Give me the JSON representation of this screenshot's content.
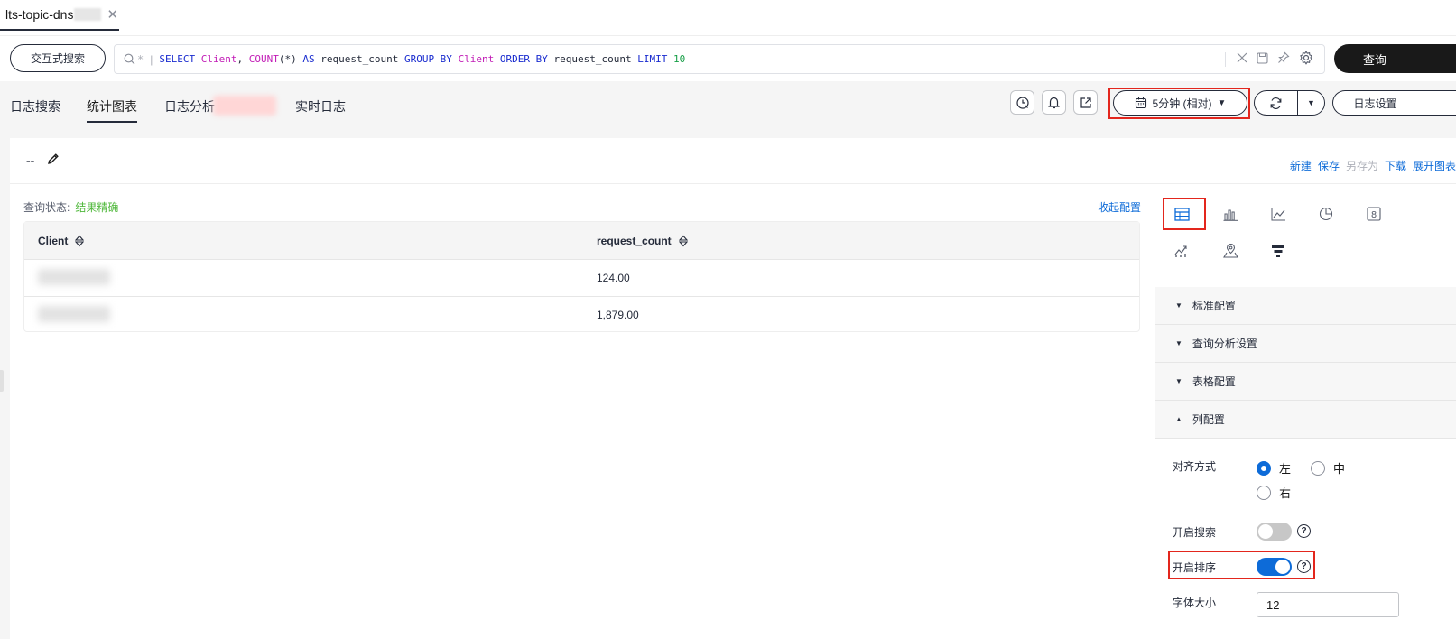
{
  "file_tab": {
    "name": "lts-topic-dns"
  },
  "query_bar": {
    "interactive_label": "交互式搜索",
    "search_star": "*",
    "sql_tokens": [
      {
        "t": "SELECT",
        "c": "kw"
      },
      {
        "t": " ",
        "c": "plain"
      },
      {
        "t": "Client",
        "c": "fn"
      },
      {
        "t": ", ",
        "c": "plain"
      },
      {
        "t": "COUNT",
        "c": "fn"
      },
      {
        "t": "(*)",
        "c": "plain"
      },
      {
        "t": " AS ",
        "c": "kw"
      },
      {
        "t": "request_count",
        "c": "plain"
      },
      {
        "t": " GROUP BY ",
        "c": "kw"
      },
      {
        "t": "Client",
        "c": "fn"
      },
      {
        "t": " ORDER BY ",
        "c": "kw"
      },
      {
        "t": "request_count",
        "c": "plain"
      },
      {
        "t": " LIMIT ",
        "c": "kw"
      },
      {
        "t": "10",
        "c": "num"
      }
    ],
    "query_label": "查询"
  },
  "tabs": [
    {
      "label": "日志搜索",
      "active": false
    },
    {
      "label": "统计图表",
      "active": true
    },
    {
      "label": "日志分析",
      "active": false
    },
    {
      "label": "实时日志",
      "active": false
    }
  ],
  "toolbar": {
    "time_range": "5分钟 (相对)",
    "log_settings": "日志设置"
  },
  "card": {
    "title": "--",
    "actions": {
      "new": "新建",
      "save": "保存",
      "save_as": "另存为",
      "download": "下载",
      "expand": "展开图表"
    },
    "query_status_label": "查询状态:",
    "query_status_value": "结果精确",
    "collapse_config": "收起配置"
  },
  "table": {
    "columns": [
      "Client",
      "request_count"
    ],
    "rows": [
      {
        "client": "",
        "count": "124.00"
      },
      {
        "client": "",
        "count": "1,879.00"
      }
    ]
  },
  "panel": {
    "sections": [
      {
        "label": "标准配置",
        "open": false
      },
      {
        "label": "查询分析设置",
        "open": false
      },
      {
        "label": "表格配置",
        "open": false
      },
      {
        "label": "列配置",
        "open": true
      }
    ],
    "align_label": "对齐方式",
    "align_options": {
      "left": "左",
      "center": "中",
      "right": "右"
    },
    "align_selected": "left",
    "search_label": "开启搜索",
    "search_on": false,
    "sort_label": "开启排序",
    "sort_on": true,
    "font_size_label": "字体大小",
    "font_size_value": "12",
    "help_glyph": "?"
  },
  "colors": {
    "accent": "#0d6bd8",
    "highlight": "#e3261d",
    "success": "#50b83c"
  }
}
